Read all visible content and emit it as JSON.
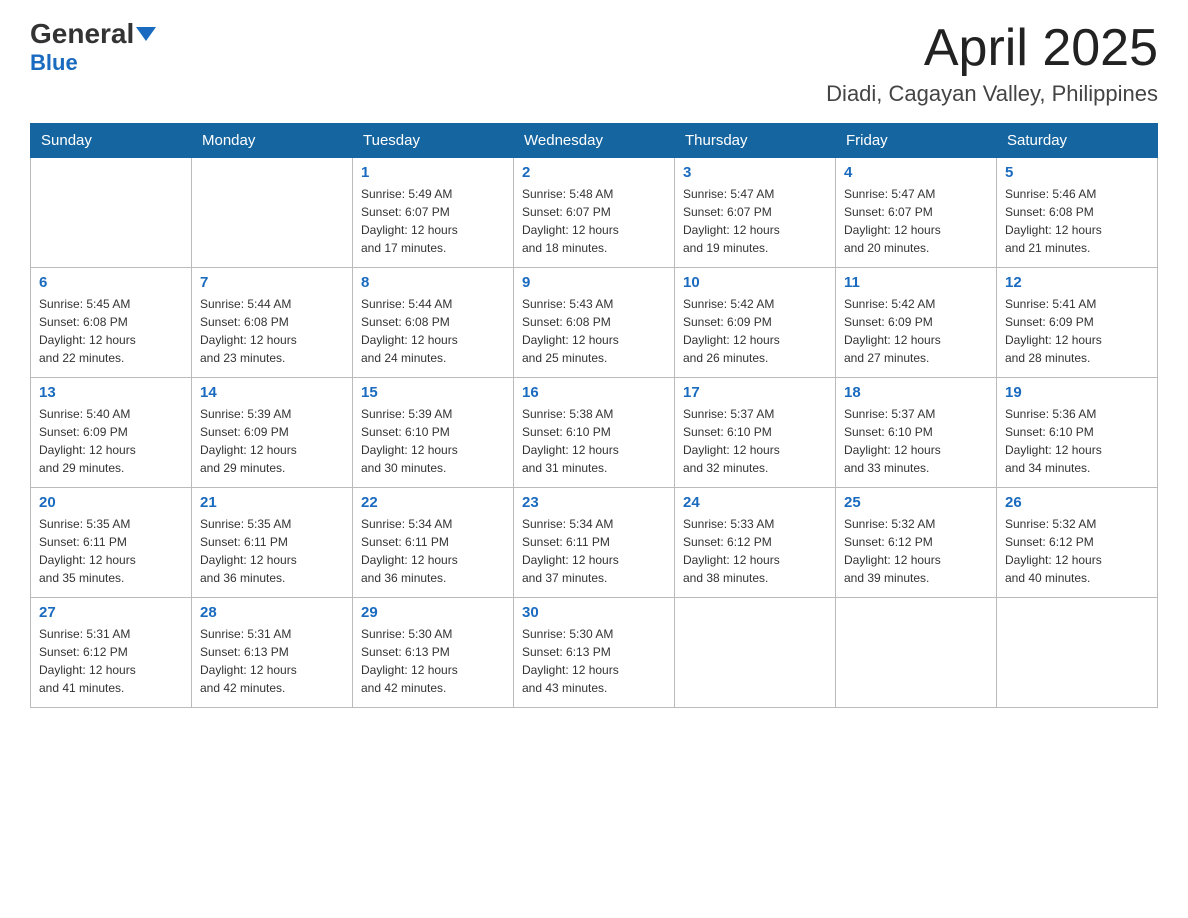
{
  "header": {
    "logo": {
      "general": "General",
      "blue": "Blue"
    },
    "title": "April 2025",
    "location": "Diadi, Cagayan Valley, Philippines"
  },
  "days_of_week": [
    "Sunday",
    "Monday",
    "Tuesday",
    "Wednesday",
    "Thursday",
    "Friday",
    "Saturday"
  ],
  "weeks": [
    [
      {
        "day": "",
        "info": ""
      },
      {
        "day": "",
        "info": ""
      },
      {
        "day": "1",
        "info": "Sunrise: 5:49 AM\nSunset: 6:07 PM\nDaylight: 12 hours\nand 17 minutes."
      },
      {
        "day": "2",
        "info": "Sunrise: 5:48 AM\nSunset: 6:07 PM\nDaylight: 12 hours\nand 18 minutes."
      },
      {
        "day": "3",
        "info": "Sunrise: 5:47 AM\nSunset: 6:07 PM\nDaylight: 12 hours\nand 19 minutes."
      },
      {
        "day": "4",
        "info": "Sunrise: 5:47 AM\nSunset: 6:07 PM\nDaylight: 12 hours\nand 20 minutes."
      },
      {
        "day": "5",
        "info": "Sunrise: 5:46 AM\nSunset: 6:08 PM\nDaylight: 12 hours\nand 21 minutes."
      }
    ],
    [
      {
        "day": "6",
        "info": "Sunrise: 5:45 AM\nSunset: 6:08 PM\nDaylight: 12 hours\nand 22 minutes."
      },
      {
        "day": "7",
        "info": "Sunrise: 5:44 AM\nSunset: 6:08 PM\nDaylight: 12 hours\nand 23 minutes."
      },
      {
        "day": "8",
        "info": "Sunrise: 5:44 AM\nSunset: 6:08 PM\nDaylight: 12 hours\nand 24 minutes."
      },
      {
        "day": "9",
        "info": "Sunrise: 5:43 AM\nSunset: 6:08 PM\nDaylight: 12 hours\nand 25 minutes."
      },
      {
        "day": "10",
        "info": "Sunrise: 5:42 AM\nSunset: 6:09 PM\nDaylight: 12 hours\nand 26 minutes."
      },
      {
        "day": "11",
        "info": "Sunrise: 5:42 AM\nSunset: 6:09 PM\nDaylight: 12 hours\nand 27 minutes."
      },
      {
        "day": "12",
        "info": "Sunrise: 5:41 AM\nSunset: 6:09 PM\nDaylight: 12 hours\nand 28 minutes."
      }
    ],
    [
      {
        "day": "13",
        "info": "Sunrise: 5:40 AM\nSunset: 6:09 PM\nDaylight: 12 hours\nand 29 minutes."
      },
      {
        "day": "14",
        "info": "Sunrise: 5:39 AM\nSunset: 6:09 PM\nDaylight: 12 hours\nand 29 minutes."
      },
      {
        "day": "15",
        "info": "Sunrise: 5:39 AM\nSunset: 6:10 PM\nDaylight: 12 hours\nand 30 minutes."
      },
      {
        "day": "16",
        "info": "Sunrise: 5:38 AM\nSunset: 6:10 PM\nDaylight: 12 hours\nand 31 minutes."
      },
      {
        "day": "17",
        "info": "Sunrise: 5:37 AM\nSunset: 6:10 PM\nDaylight: 12 hours\nand 32 minutes."
      },
      {
        "day": "18",
        "info": "Sunrise: 5:37 AM\nSunset: 6:10 PM\nDaylight: 12 hours\nand 33 minutes."
      },
      {
        "day": "19",
        "info": "Sunrise: 5:36 AM\nSunset: 6:10 PM\nDaylight: 12 hours\nand 34 minutes."
      }
    ],
    [
      {
        "day": "20",
        "info": "Sunrise: 5:35 AM\nSunset: 6:11 PM\nDaylight: 12 hours\nand 35 minutes."
      },
      {
        "day": "21",
        "info": "Sunrise: 5:35 AM\nSunset: 6:11 PM\nDaylight: 12 hours\nand 36 minutes."
      },
      {
        "day": "22",
        "info": "Sunrise: 5:34 AM\nSunset: 6:11 PM\nDaylight: 12 hours\nand 36 minutes."
      },
      {
        "day": "23",
        "info": "Sunrise: 5:34 AM\nSunset: 6:11 PM\nDaylight: 12 hours\nand 37 minutes."
      },
      {
        "day": "24",
        "info": "Sunrise: 5:33 AM\nSunset: 6:12 PM\nDaylight: 12 hours\nand 38 minutes."
      },
      {
        "day": "25",
        "info": "Sunrise: 5:32 AM\nSunset: 6:12 PM\nDaylight: 12 hours\nand 39 minutes."
      },
      {
        "day": "26",
        "info": "Sunrise: 5:32 AM\nSunset: 6:12 PM\nDaylight: 12 hours\nand 40 minutes."
      }
    ],
    [
      {
        "day": "27",
        "info": "Sunrise: 5:31 AM\nSunset: 6:12 PM\nDaylight: 12 hours\nand 41 minutes."
      },
      {
        "day": "28",
        "info": "Sunrise: 5:31 AM\nSunset: 6:13 PM\nDaylight: 12 hours\nand 42 minutes."
      },
      {
        "day": "29",
        "info": "Sunrise: 5:30 AM\nSunset: 6:13 PM\nDaylight: 12 hours\nand 42 minutes."
      },
      {
        "day": "30",
        "info": "Sunrise: 5:30 AM\nSunset: 6:13 PM\nDaylight: 12 hours\nand 43 minutes."
      },
      {
        "day": "",
        "info": ""
      },
      {
        "day": "",
        "info": ""
      },
      {
        "day": "",
        "info": ""
      }
    ]
  ]
}
